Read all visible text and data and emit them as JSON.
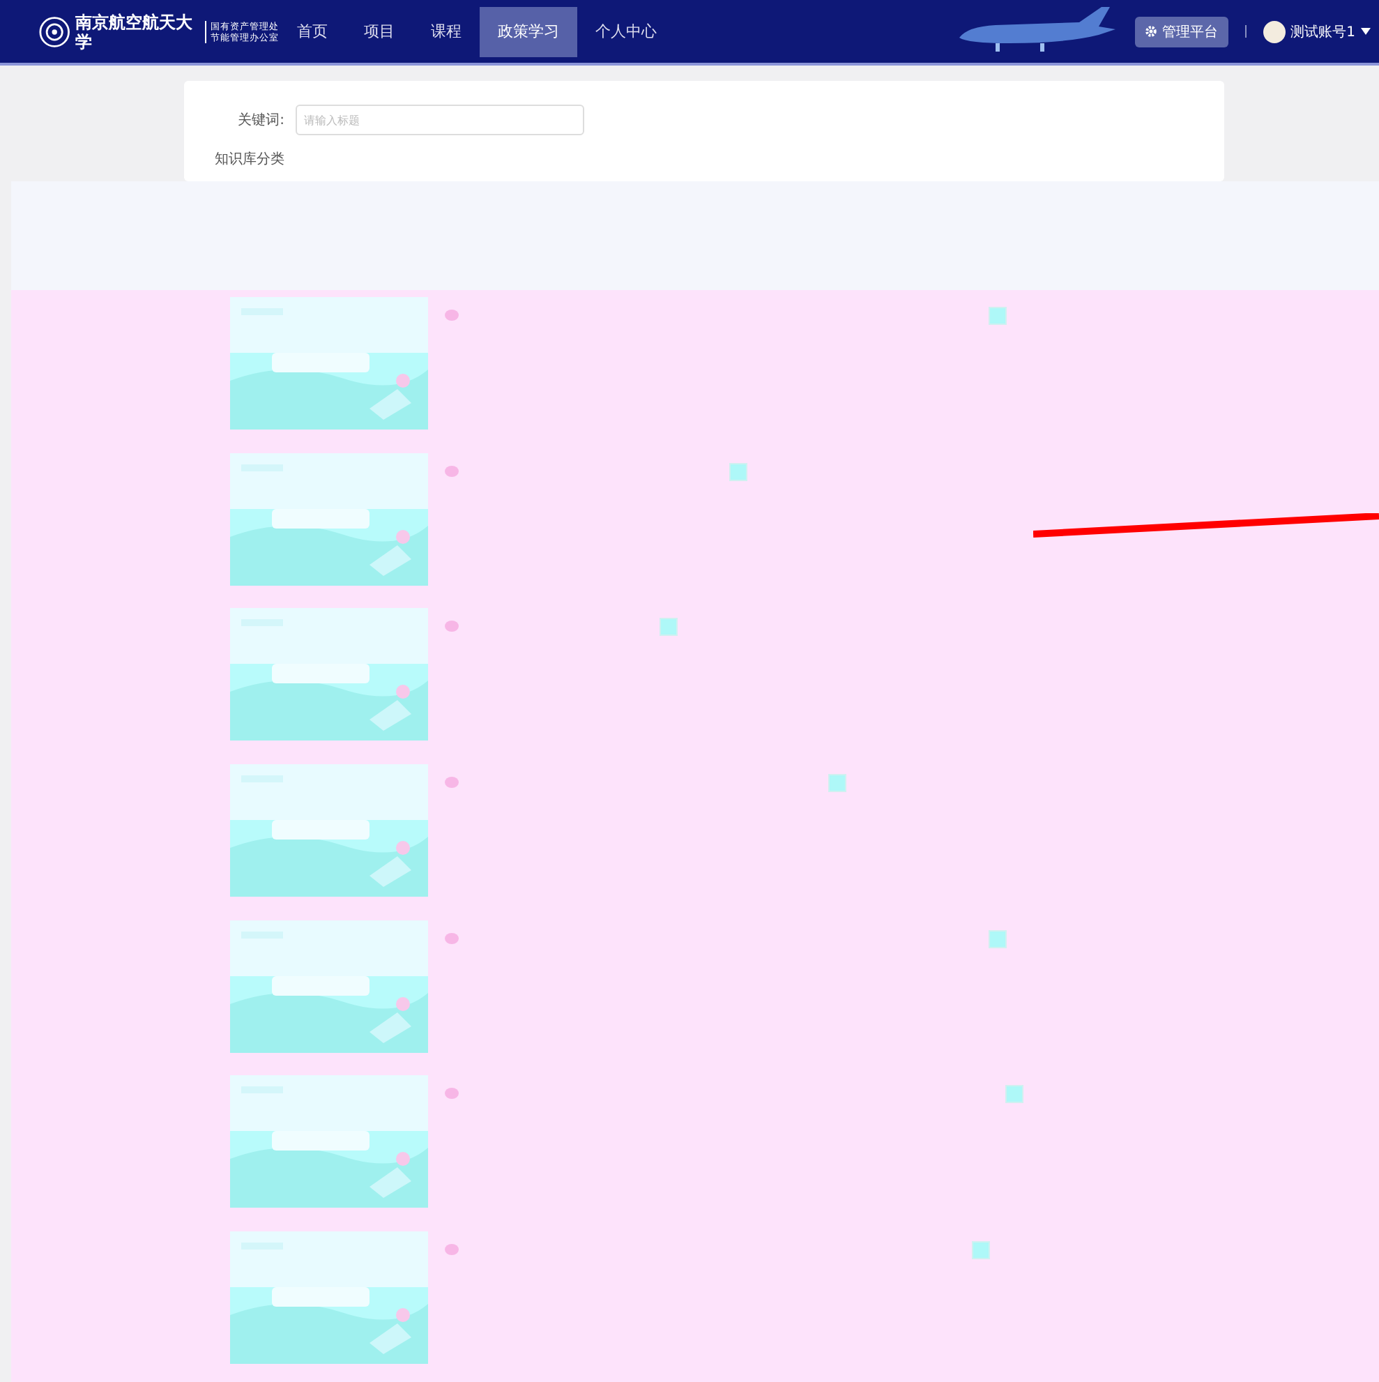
{
  "header": {
    "logo_name": "南京航空航天大学",
    "office_lines": [
      "国有资产管理处",
      "节能管理办公室"
    ],
    "nav": [
      {
        "label": "首页",
        "selected": false
      },
      {
        "label": "项目",
        "selected": false
      },
      {
        "label": "课程",
        "selected": false
      },
      {
        "label": "政策学习",
        "selected": true
      },
      {
        "label": "个人中心",
        "selected": false
      }
    ],
    "admin_button": "管理平台",
    "user": "测试账号1"
  },
  "search": {
    "keyword_label": "关键词:",
    "keyword_placeholder": "请输入标题",
    "category_label": "知识库分类"
  }
}
